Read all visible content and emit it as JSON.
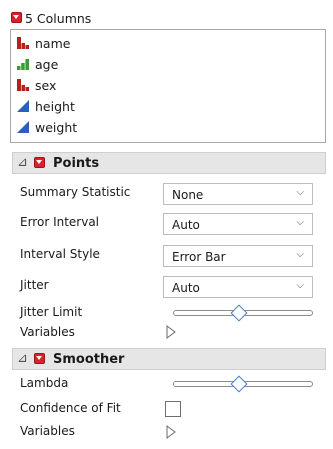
{
  "columns": {
    "title": "5 Columns",
    "items": [
      {
        "label": "name",
        "icon": "nominal-icon"
      },
      {
        "label": "age",
        "icon": "ordinal-icon"
      },
      {
        "label": "sex",
        "icon": "nominal-icon"
      },
      {
        "label": "height",
        "icon": "continuous-icon"
      },
      {
        "label": "weight",
        "icon": "continuous-icon"
      }
    ]
  },
  "points": {
    "title": "Points",
    "summary_statistic": {
      "label": "Summary Statistic",
      "value": "None"
    },
    "error_interval": {
      "label": "Error Interval",
      "value": "Auto"
    },
    "interval_style": {
      "label": "Interval Style",
      "value": "Error Bar"
    },
    "jitter": {
      "label": "Jitter",
      "value": "Auto"
    },
    "jitter_limit": {
      "label": "Jitter Limit",
      "position": 0.48
    },
    "variables": {
      "label": "Variables"
    }
  },
  "smoother": {
    "title": "Smoother",
    "lambda": {
      "label": "Lambda",
      "position": 0.48
    },
    "confidence_of_fit": {
      "label": "Confidence of Fit",
      "checked": false
    },
    "variables": {
      "label": "Variables"
    }
  },
  "colors": {
    "nominal": "#b32317",
    "ordinal": "#3a9b3a",
    "continuous": "#2d5fb8",
    "menu_red": "#d9222a"
  }
}
